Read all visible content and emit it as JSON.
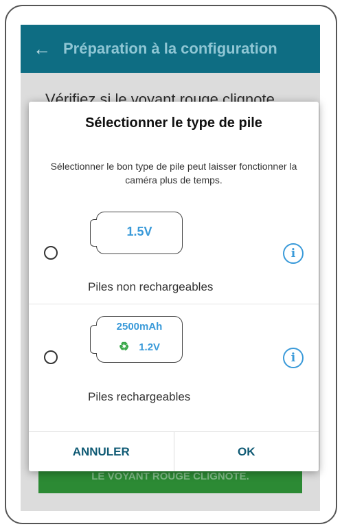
{
  "appbar": {
    "back_icon": "arrow-left-icon",
    "title": "Préparation à la configuration"
  },
  "background": {
    "instruction": "Vérifiez si le voyant rouge clignote",
    "confirm_button": "LE VOYANT ROUGE CLIGNOTE."
  },
  "dialog": {
    "title": "Sélectionner le type de pile",
    "description": "Sélectionner le bon type de pile peut laisser fonctionner la caméra plus de temps.",
    "options": [
      {
        "voltage": "1.5V",
        "label": "Piles non rechargeables",
        "selected": false,
        "info_icon": "info-icon"
      },
      {
        "capacity": "2500mAh",
        "voltage": "1.2V",
        "label": "Piles rechargeables",
        "recycle_icon": "recycle-icon",
        "selected": false,
        "info_icon": "info-icon"
      }
    ],
    "cancel_label": "ANNULER",
    "ok_label": "OK"
  },
  "colors": {
    "appbar": "#0e6d83",
    "accent_blue": "#3a9ad9",
    "recycle_green": "#3aa84a",
    "button_text": "#0f5a74",
    "background_button": "#2c8a34"
  }
}
